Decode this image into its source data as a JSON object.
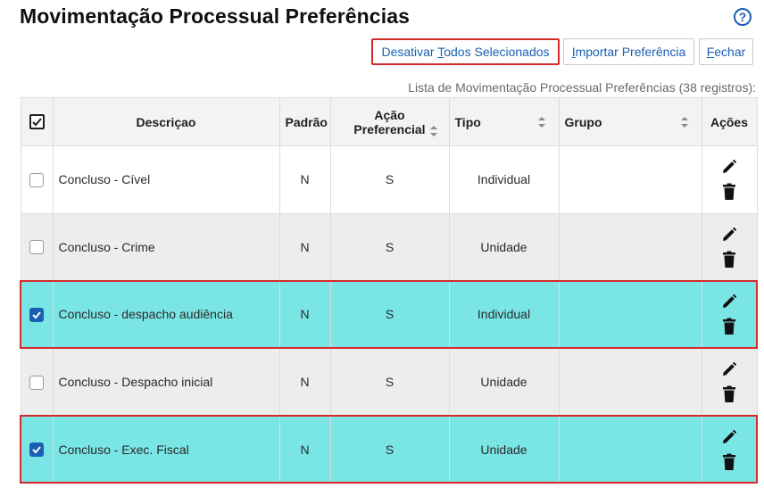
{
  "header": {
    "title": "Movimentação Processual Preferências",
    "help_glyph": "?"
  },
  "toolbar": {
    "disable_all_label_pre": "Desativar ",
    "disable_all_label_key": "T",
    "disable_all_label_post": "odos Selecionados",
    "import_label_key": "I",
    "import_label_post": "mportar Preferência",
    "close_label_key": "F",
    "close_label_post": "echar"
  },
  "records_info": "Lista de Movimentação Processual Preferências (38 registros):",
  "table": {
    "columns": {
      "descricao": "Descriçao",
      "padrao": "Padrão",
      "acao_line1": "Ação",
      "acao_line2": "Preferencial",
      "tipo": "Tipo",
      "grupo": "Grupo",
      "acoes": "Ações"
    },
    "rows": [
      {
        "descricao": "Concluso - Cível",
        "padrao": "N",
        "acao": "S",
        "tipo": "Individual",
        "grupo": "",
        "checked": false
      },
      {
        "descricao": "Concluso - Crime",
        "padrao": "N",
        "acao": "S",
        "tipo": "Unidade",
        "grupo": "",
        "checked": false
      },
      {
        "descricao": "Concluso - despacho audiência",
        "padrao": "N",
        "acao": "S",
        "tipo": "Individual",
        "grupo": "",
        "checked": true
      },
      {
        "descricao": "Concluso - Despacho inicial",
        "padrao": "N",
        "acao": "S",
        "tipo": "Unidade",
        "grupo": "",
        "checked": false
      },
      {
        "descricao": "Concluso - Exec. Fiscal",
        "padrao": "N",
        "acao": "S",
        "tipo": "Unidade",
        "grupo": "",
        "checked": true
      }
    ]
  },
  "icons": {
    "edit": "pencil-icon",
    "delete": "trash-icon",
    "sort": "sort-icon",
    "help": "help-circle-icon"
  },
  "colors": {
    "accent": "#1a5fb4",
    "selected_row": "#7ae5e5",
    "highlight_border": "#d42a2a"
  }
}
